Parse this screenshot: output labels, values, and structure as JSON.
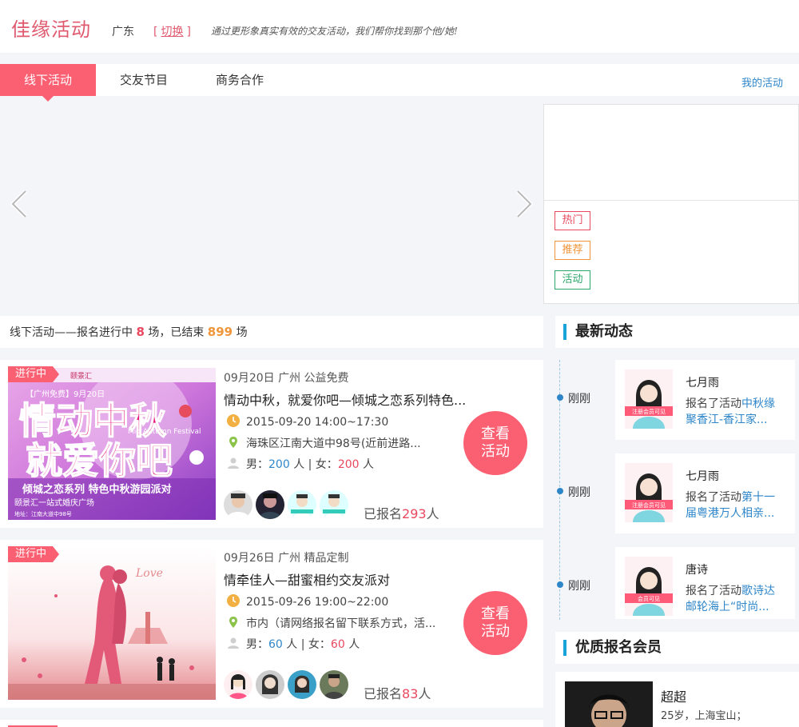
{
  "header": {
    "logo": "佳缘活动",
    "city": "广东",
    "switch_label": "切换",
    "slogan": "通过更形象真实有效的交友活动，我们帮你找到那个他/她!"
  },
  "nav": {
    "tabs": [
      "线下活动",
      "交友节目",
      "商务合作"
    ],
    "active": 0,
    "my_activities": "我的活动"
  },
  "tags": [
    {
      "label": "热门",
      "color": "#e9485f"
    },
    {
      "label": "推荐",
      "color": "#f0953a"
    },
    {
      "label": "活动",
      "color": "#2aa86a"
    }
  ],
  "stats": {
    "prefix": "线下活动——报名进行中",
    "ongoing": "8",
    "mid": "场，已结束",
    "ended": "899",
    "suffix": "场"
  },
  "events": [
    {
      "status": "进行中",
      "date_meta": "09月20日 广州 公益免费",
      "title": "情动中秋，就爱你吧—倾城之恋系列特色...",
      "time": "2015-09-20 14:00~17:30",
      "location": "海珠区江南大道中98号(近前进路...",
      "male_label": "男：",
      "male": "200",
      "female_label": "人 | 女：",
      "female": "200",
      "unit": "人",
      "view_line1": "查看",
      "view_line2": "活动",
      "signed_prefix": "已报名",
      "signed": "293",
      "signed_suffix": "人",
      "poster": {
        "top_label": "【广州免费】9月20日",
        "brand": "颐景汇",
        "big1": "情动中秋",
        "big2": "就爱你吧",
        "festival": "Mid Autumn Festival",
        "series": "倾城之恋系列 特色中秋游园派对",
        "venue": "颐景汇一站式婚庆广场",
        "address": "地址：江南大道中98号"
      }
    },
    {
      "status": "进行中",
      "date_meta": "09月26日 广州 精品定制",
      "title": "情牵佳人—甜蜜相约交友派对",
      "time": "2015-09-26 19:00~22:00",
      "location": "市内（请网络报名留下联系方式，活...",
      "male_label": "男：",
      "male": "60",
      "female_label": "人 | 女：",
      "female": "60",
      "unit": "人",
      "view_line1": "查看",
      "view_line2": "活动",
      "signed_prefix": "已报名",
      "signed": "83",
      "signed_suffix": "人",
      "poster": {
        "script": "Love"
      }
    }
  ],
  "feed": {
    "title": "最新动态",
    "items": [
      {
        "time": "刚刚",
        "name": "七月雨",
        "action": "报名了活动",
        "activity": "中秋缘聚香江-香江家...",
        "avatar_caption": "注册会员可见"
      },
      {
        "time": "刚刚",
        "name": "七月雨",
        "action": "报名了活动",
        "activity": "第十一届粤港万人相亲...",
        "avatar_caption": "注册会员可见"
      },
      {
        "time": "刚刚",
        "name": "唐诗",
        "action": "报名了活动",
        "activity": "歌诗达邮轮海上“时尚...",
        "avatar_caption": "会员可见"
      }
    ]
  },
  "members": {
    "title": "优质报名会员",
    "items": [
      {
        "name": "超超",
        "info": "25岁，上海宝山；"
      }
    ]
  },
  "colors": {
    "accent": "#fa5f72",
    "link": "#2e86c9",
    "count_red": "#e9485f",
    "count_orange": "#f0953a"
  }
}
